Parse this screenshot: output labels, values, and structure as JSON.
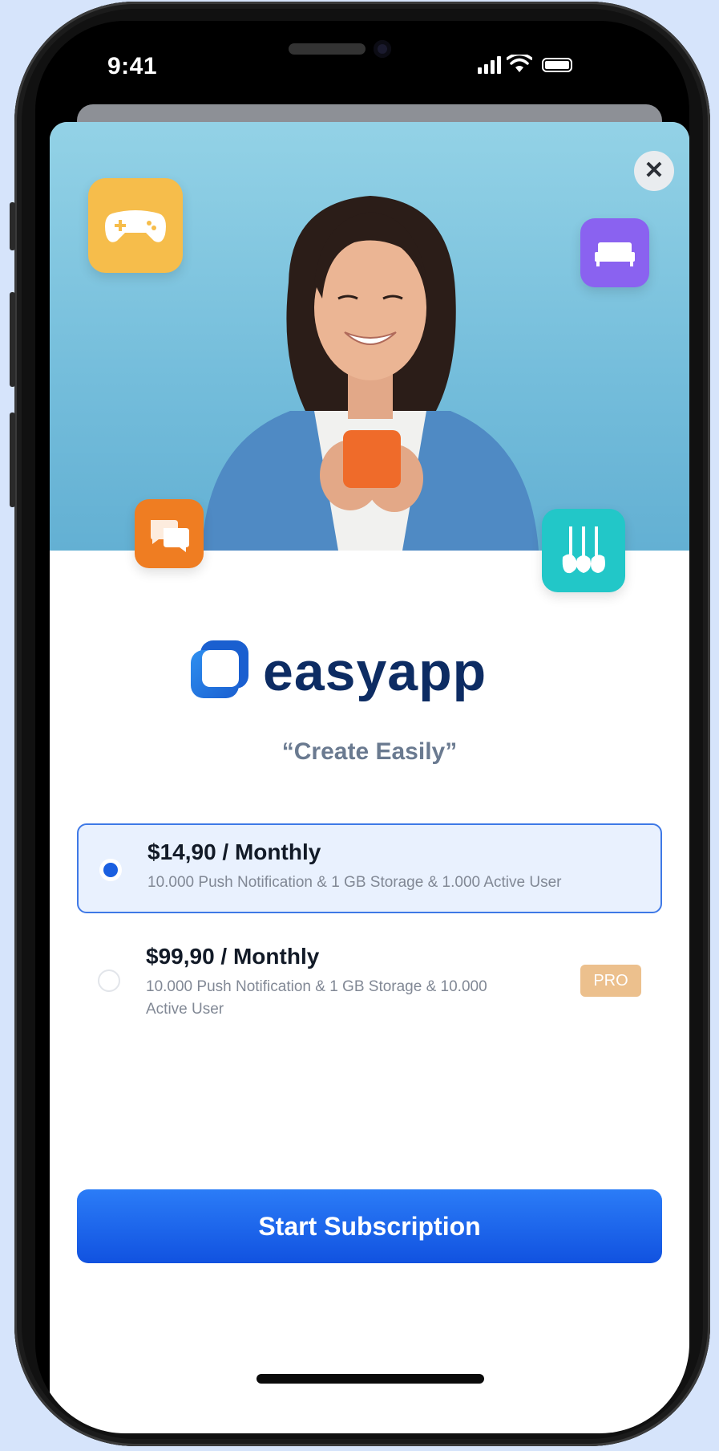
{
  "status_bar": {
    "time": "9:41",
    "icons": [
      "signal-icon",
      "wifi-icon",
      "battery-icon"
    ]
  },
  "hero": {
    "close_icon": "close-icon",
    "floating_icons": [
      "gamepad-icon",
      "bed-icon",
      "chat-icon",
      "music-instruments-icon"
    ],
    "colors": {
      "gamepad": "#f6bd4b",
      "bed": "#8a62f0",
      "chat": "#ef7d22",
      "music": "#22c7c8",
      "background": "#7cc3de"
    }
  },
  "brand": {
    "name": "easyapp",
    "tagline": "“Create Easily”",
    "color": "#0d2c63",
    "logo_color": "#2e8ff0"
  },
  "plans": [
    {
      "title": "$14,90 / Monthly",
      "description": "10.000 Push Notification & 1 GB Storage & 1.000 Active User",
      "selected": true
    },
    {
      "title": "$99,90 / Monthly",
      "description": "10.000 Push Notification & 1 GB Storage & 10.000 Active User",
      "badge": "PRO",
      "selected": false
    }
  ],
  "cta": {
    "label": "Start Subscription",
    "color": "#1a62ec"
  }
}
